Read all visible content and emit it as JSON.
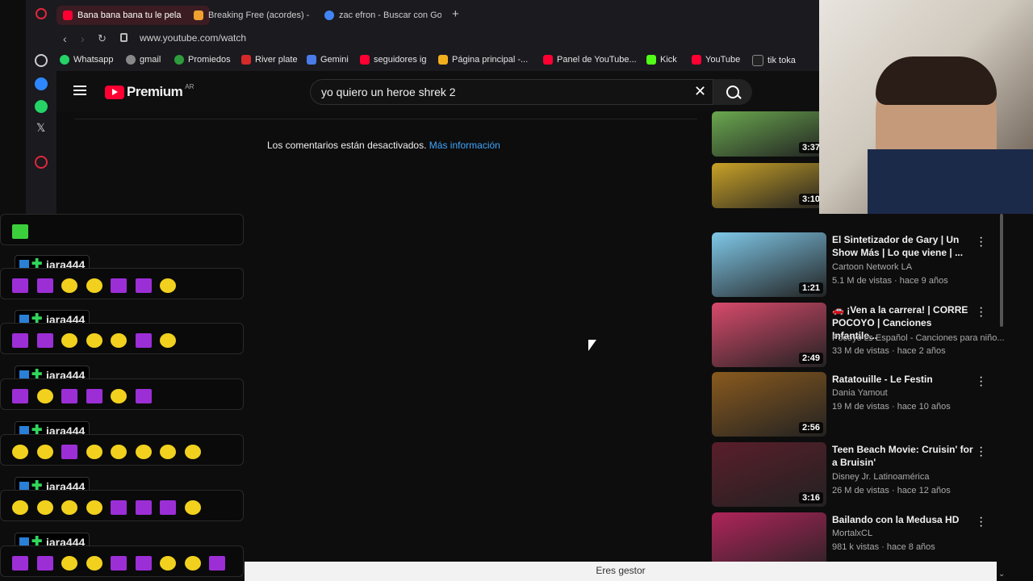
{
  "tabs": [
    {
      "label": "Bana bana bana tu le pela",
      "active": true
    },
    {
      "label": "Breaking Free (acordes) -",
      "active": false
    },
    {
      "label": "zac efron - Buscar con Go",
      "active": false
    }
  ],
  "new_tab": "+",
  "address": "www.youtube.com/watch",
  "bookmarks": [
    "Whatsapp",
    "gmail",
    "Promiedos",
    "River plate",
    "Gemini",
    "seguidores ig",
    "Página principal -...",
    "Panel de YouTube...",
    "Kick",
    "YouTube",
    "tik toka"
  ],
  "youtube": {
    "logo": "Premium",
    "logo_region": "AR",
    "search_value": "yo quiero un heroe shrek 2",
    "comments_text": "Los comentarios están desactivados.",
    "comments_link": "Más información"
  },
  "chat": {
    "username": "iara444",
    "rows": [
      [
        "cat",
        "cat",
        "ball",
        "ball",
        "cat",
        "cat",
        "ball"
      ],
      [
        "cat",
        "cat",
        "ball",
        "ball",
        "ball",
        "cat",
        "ball"
      ],
      [
        "cat",
        "ball",
        "cat",
        "cat",
        "ball",
        "cat"
      ],
      [
        "ball",
        "ball",
        "cat",
        "ball",
        "ball",
        "ball",
        "ball",
        "ball"
      ],
      [
        "ball",
        "ball",
        "ball",
        "ball",
        "cat",
        "cat",
        "cat",
        "ball"
      ],
      [
        "cat",
        "cat",
        "ball",
        "ball",
        "cat",
        "cat",
        "ball",
        "ball",
        "cat"
      ]
    ]
  },
  "recommendations": [
    {
      "title": "",
      "channel": "",
      "meta": "",
      "duration": "3:37",
      "color": "#6aa84f"
    },
    {
      "title": "",
      "channel": "",
      "meta": "",
      "duration": "3:10",
      "color": "#c9a227"
    },
    {
      "title": "El Sintetizador de Gary | Un Show Más | Lo que viene | ...",
      "channel": "Cartoon Network LA",
      "meta": "5.1 M de vistas · hace 9 años",
      "duration": "1:21",
      "color": "#7fc8e8"
    },
    {
      "title": "🚗 ¡Ven a la carrera! | CORRE POCOYO | Canciones Infantile...",
      "channel": "Pocoyo ᴇꜱ Español - Canciones para niño...",
      "meta": "33 M de vistas · hace 2 años",
      "duration": "2:49",
      "color": "#d84a6c"
    },
    {
      "title": "Ratatouille - Le Festin",
      "channel": "Dania Yamout",
      "meta": "19 M de vistas · hace 10 años",
      "duration": "2:56",
      "color": "#8a5a1e"
    },
    {
      "title": "Teen Beach Movie: Cruisin' for a Bruisin'",
      "channel": "Disney Jr. Latinoamérica",
      "meta": "26 M de vistas · hace 12 años",
      "duration": "3:16",
      "color": "#5a1e2a"
    },
    {
      "title": "Bailando con la Medusa HD",
      "channel": "MortalxCL",
      "meta": "981 k vistas · hace 8 años",
      "duration": "",
      "color": "#b0245a"
    }
  ],
  "status_bar": "Eres gestor",
  "colors": {
    "accent": "#ff0033",
    "link": "#3ea6ff",
    "tab_active": "#3a1c22"
  }
}
